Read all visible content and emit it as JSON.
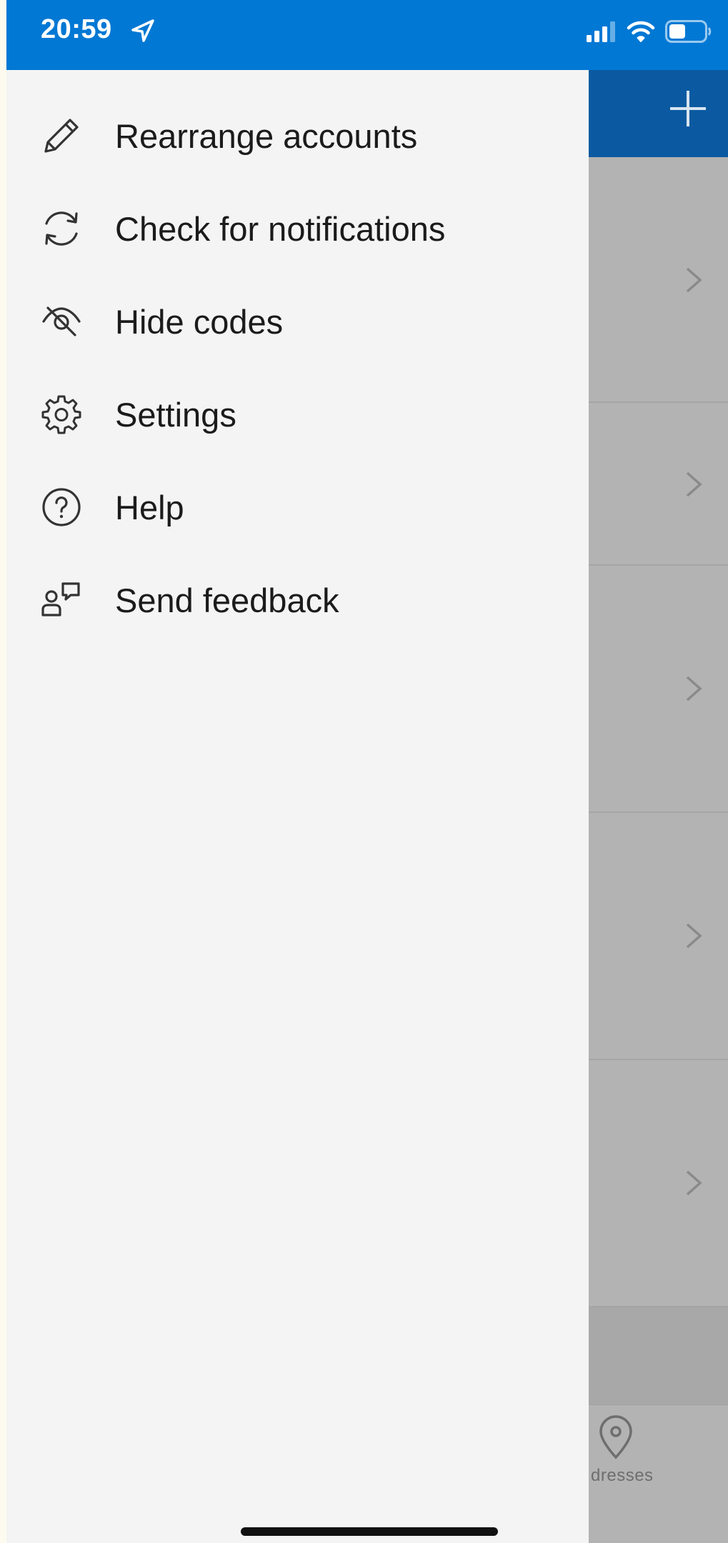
{
  "status_bar": {
    "time": "20:59",
    "location_icon": "location-arrow-icon",
    "signal_icon": "cellular-signal-icon",
    "wifi_icon": "wifi-icon",
    "battery_icon": "battery-icon"
  },
  "drawer": {
    "items": [
      {
        "label": "Rearrange accounts",
        "icon": "pencil-icon"
      },
      {
        "label": "Check for notifications",
        "icon": "refresh-icon"
      },
      {
        "label": "Hide codes",
        "icon": "eye-off-icon"
      },
      {
        "label": "Settings",
        "icon": "gear-icon"
      },
      {
        "label": "Help",
        "icon": "help-circle-icon"
      },
      {
        "label": "Send feedback",
        "icon": "feedback-icon"
      }
    ]
  },
  "background": {
    "add_icon": "plus-icon",
    "tab_bar": {
      "visible_tab_label": "dresses",
      "visible_tab_icon": "location-pin-icon"
    }
  },
  "colors": {
    "status_bar": "#0078d4",
    "header": "#0b5aa1",
    "drawer_bg": "#f4f4f4",
    "overlay_bg": "#b3b3b3",
    "text": "#1b1b1b"
  }
}
